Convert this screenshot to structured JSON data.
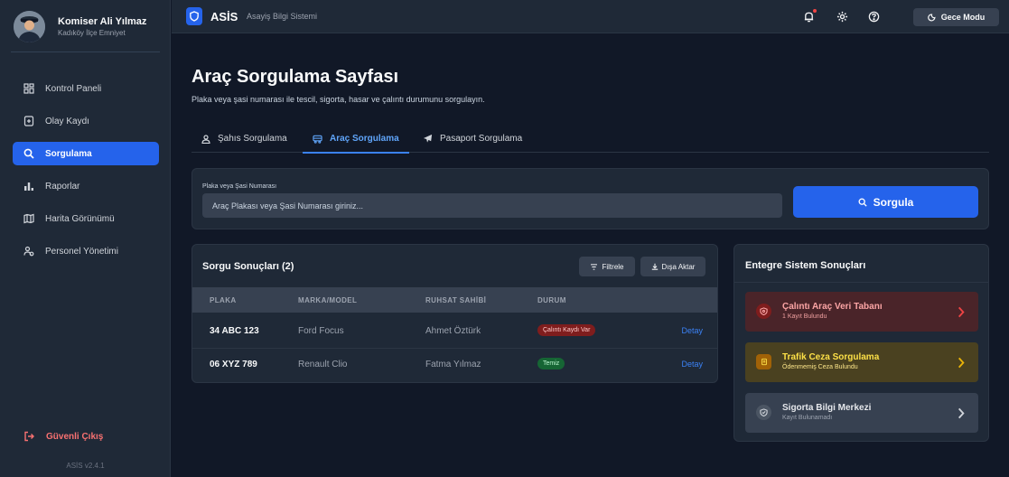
{
  "user": {
    "name": "Komiser Ali Yılmaz",
    "unit": "Kadıköy İlçe Emniyet"
  },
  "sidebar": {
    "items": [
      {
        "label": "Kontrol Paneli",
        "icon": "dashboard-icon"
      },
      {
        "label": "Olay Kaydı",
        "icon": "file-plus-icon"
      },
      {
        "label": "Sorgulama",
        "icon": "search-icon",
        "active": true
      },
      {
        "label": "Raporlar",
        "icon": "bar-chart-icon"
      },
      {
        "label": "Harita Görünümü",
        "icon": "map-icon"
      },
      {
        "label": "Personel Yönetimi",
        "icon": "users-icon"
      }
    ],
    "logout_label": "Güvenli Çıkış",
    "version": "ASİS v2.4.1"
  },
  "topbar": {
    "brand": "ASİS",
    "subtitle": "Asayiş Bilgi Sistemi",
    "night_mode_label": "Gece Modu"
  },
  "page": {
    "title": "Araç Sorgulama Sayfası",
    "subtitle": "Plaka veya şasi numarası ile tescil, sigorta, hasar ve çalıntı durumunu sorgulayın."
  },
  "tabs": [
    {
      "label": "Şahıs Sorgulama",
      "icon": "person-icon"
    },
    {
      "label": "Araç Sorgulama",
      "icon": "car-icon",
      "active": true
    },
    {
      "label": "Pasaport Sorgulama",
      "icon": "plane-icon"
    }
  ],
  "search": {
    "label": "Plaka veya Şasi Numarası",
    "placeholder": "Araç Plakası veya Şasi Numarası giriniz...",
    "value": "",
    "button_label": "Sorgula"
  },
  "results": {
    "title": "Sorgu Sonuçları (2)",
    "filter_label": "Filtrele",
    "export_label": "Dışa Aktar",
    "columns": [
      "PLAKA",
      "MARKA/MODEL",
      "RUHSAT SAHİBİ",
      "DURUM"
    ],
    "rows": [
      {
        "plate": "34 ABC 123",
        "model": "Ford Focus",
        "owner": "Ahmet Öztürk",
        "status": "Çalıntı Kaydı Var",
        "status_color": "#7f1d1d",
        "action": "Detay"
      },
      {
        "plate": "06 XYZ 789",
        "model": "Renault Clio",
        "owner": "Fatma Yılmaz",
        "status": "Temiz",
        "status_color": "#166534",
        "action": "Detay"
      }
    ]
  },
  "integrated": {
    "title": "Entegre Sistem Sonuçları",
    "items": [
      {
        "title": "Çalıntı Araç Veri Tabanı",
        "subtitle": "1 Kayıt Bulundu",
        "icon": "shield-alert-icon",
        "color": "#ef4444"
      },
      {
        "title": "Trafik Ceza Sorgulama",
        "subtitle": "Ödenmemiş Ceza Bulundu",
        "icon": "receipt-icon",
        "color": "#eab308"
      },
      {
        "title": "Sigorta Bilgi Merkezi",
        "subtitle": "Kayıt Bulunamadı",
        "icon": "shield-check-icon",
        "color": "#9ca3af"
      }
    ]
  },
  "colors": {
    "accent": "#2563eb",
    "background": "#111827",
    "panel": "#1f2937"
  }
}
